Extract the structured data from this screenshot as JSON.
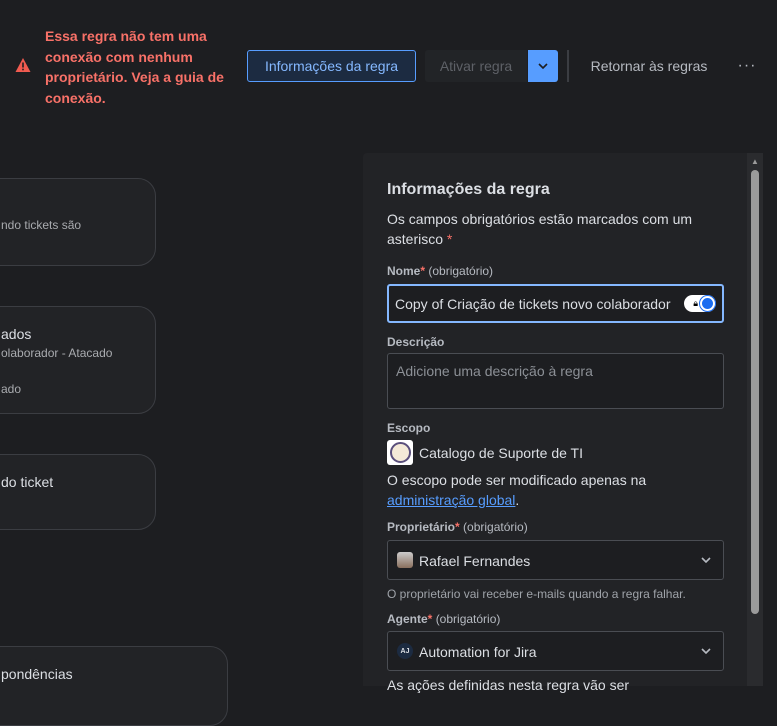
{
  "header": {
    "warning": "Essa regra não tem uma conexão com nenhum proprietário. Veja a guia de conexão.",
    "info_button": "Informações da regra",
    "activate_button": "Ativar regra",
    "return_button": "Retornar às regras",
    "more": "···"
  },
  "canvas": {
    "cards": [
      {
        "title": "",
        "subtitle": "ndo tickets são"
      },
      {
        "title": "ados",
        "subtitle": "olaborador - Atacado",
        "subtitle2": "ado"
      },
      {
        "title": "do ticket"
      },
      {
        "title": "pondências"
      }
    ]
  },
  "panel": {
    "title": "Informações da regra",
    "required_note": "Os campos obrigatórios estão marcados com um asterisco",
    "required_star": "*",
    "name_label": "Nome",
    "optional_text": "(obrigatório)",
    "name_value": "Copy of Criação de tickets novo colaborador",
    "description_label": "Descrição",
    "description_placeholder": "Adicione uma descrição à regra",
    "scope_label": "Escopo",
    "scope_value": "Catalogo de Suporte de TI",
    "scope_note": "O escopo pode ser modificado apenas na",
    "scope_link": "administração global",
    "scope_end": ".",
    "owner_label": "Proprietário",
    "owner_value": "Rafael Fernandes",
    "owner_help": "O proprietário vai receber e-mails quando a regra falhar.",
    "agent_label": "Agente",
    "agent_initials": "AJ",
    "agent_value": "Automation for Jira",
    "actions_note": "As ações definidas nesta regra vão ser"
  }
}
